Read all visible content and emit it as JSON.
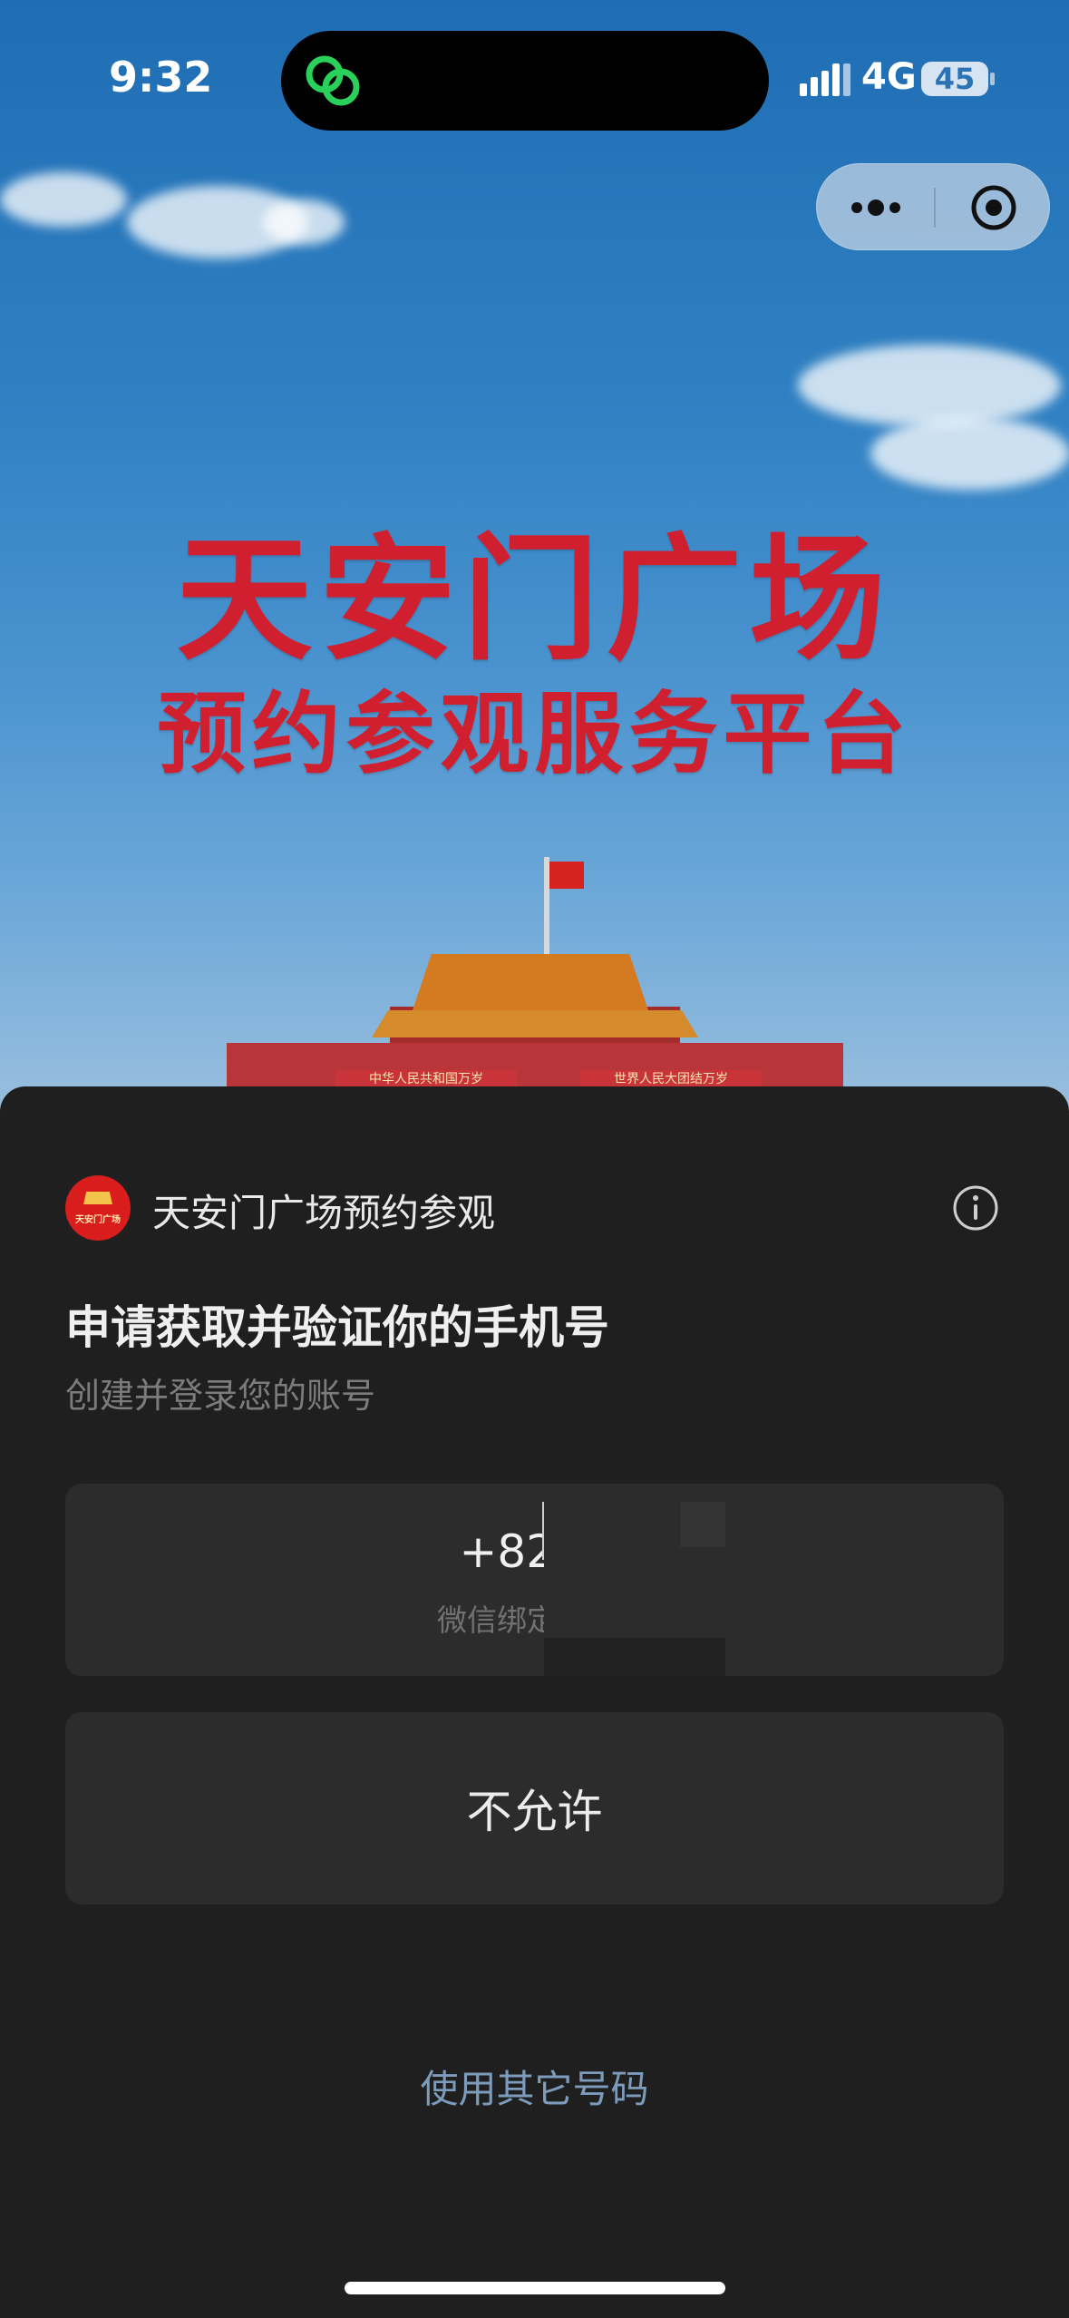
{
  "status_bar": {
    "time": "9:32",
    "network": "4G",
    "battery": "45"
  },
  "capsule": {
    "more_icon": "more-dots-icon",
    "close_icon": "target-close-icon"
  },
  "hero": {
    "title_line1": "天安门广场",
    "title_line2": "预约参观服务平台",
    "banner_left": "中华人民共和国万岁",
    "banner_right": "世界人民大团结万岁"
  },
  "sheet": {
    "app_name": "天安门广场预约参观",
    "app_logo_text": "天安门广场",
    "request_title": "申请获取并验证你的手机号",
    "request_subtitle": "创建并登录您的账号",
    "phone_number": "+82106*",
    "phone_hint": "微信绑定",
    "deny_label": "不允许",
    "other_number_label": "使用其它号码"
  },
  "colors": {
    "accent_link": "#7d9bbb",
    "sheet_bg": "#1f1f1f",
    "card_bg": "#2c2c2c",
    "hero_title": "#d0202f"
  }
}
